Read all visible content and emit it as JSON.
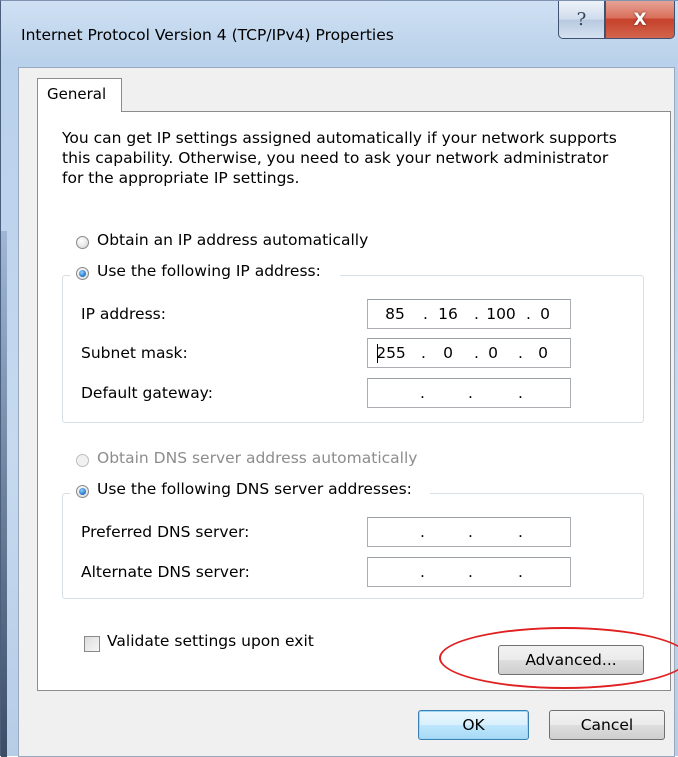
{
  "window": {
    "title": "Internet Protocol Version 4 (TCP/IPv4) Properties",
    "help_glyph": "?",
    "close_glyph": "X"
  },
  "tabs": [
    {
      "label": "General",
      "active": true
    }
  ],
  "intro_text_lines": [
    "You can get IP settings assigned automatically if your network supports",
    "this capability. Otherwise, you need to ask your network administrator",
    "for the appropriate IP settings."
  ],
  "ip": {
    "auto_label": "Obtain an IP address automatically",
    "manual_label": "Use the following IP address:",
    "selected": "manual",
    "fields": {
      "ip_address": {
        "label": "IP address:",
        "octets": [
          "85",
          "16",
          "100",
          "0"
        ]
      },
      "subnet_mask": {
        "label": "Subnet mask:",
        "octets": [
          "255",
          "0",
          "0",
          "0"
        ]
      },
      "default_gateway": {
        "label": "Default gateway:",
        "octets": [
          "",
          "",
          "",
          ""
        ]
      }
    }
  },
  "dns": {
    "auto_label": "Obtain DNS server address automatically",
    "manual_label": "Use the following DNS server addresses:",
    "selected": "manual",
    "auto_enabled": false,
    "fields": {
      "preferred": {
        "label": "Preferred DNS server:",
        "octets": [
          "",
          "",
          "",
          ""
        ]
      },
      "alternate": {
        "label": "Alternate DNS server:",
        "octets": [
          "",
          "",
          "",
          ""
        ]
      }
    }
  },
  "validate_label": "Validate settings upon exit",
  "validate_checked": false,
  "buttons": {
    "advanced": "Advanced...",
    "ok": "OK",
    "cancel": "Cancel"
  },
  "colors": {
    "annotation": "#e02020",
    "radio_selected": "#1f6fc6"
  }
}
